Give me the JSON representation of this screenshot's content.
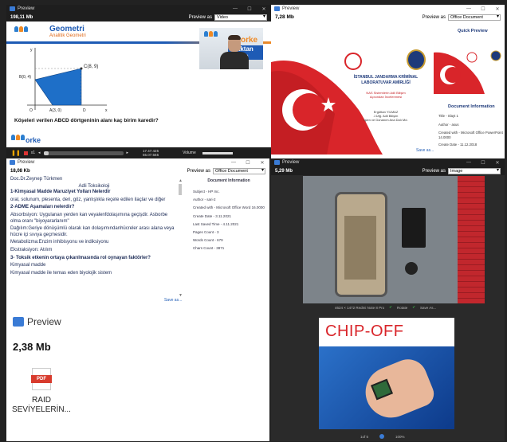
{
  "panels": {
    "video": {
      "title": "Preview",
      "size": "198,11 Mb",
      "preview_as_label": "Preview as",
      "preview_as_value": "Video",
      "slide_title": "Geometri",
      "slide_subtitle": "Analitik Geometri",
      "logo_text": "orke",
      "webcam_brand_line1": "orke",
      "webcam_brand_line2": "uzaktan eğitim",
      "question": "Köşeleri verilen ABCD dörtgeninin alanı kaç birim karedir?",
      "pt_B": "B(0, 4)",
      "pt_C": "C(8, 9)",
      "pt_A": "A(3, 0)",
      "pt_D": "D",
      "axis_x": "x",
      "axis_y": "y",
      "origin": "O",
      "speed": "x1",
      "time_current": "17.47.425",
      "time_total": "55.07.565",
      "volume_label": "Volume"
    },
    "office": {
      "title": "Preview",
      "size": "7,28 Mb",
      "preview_as_label": "Preview as",
      "preview_as_value": "Office Document",
      "quick_preview": "Quick Preview",
      "org_line1": "İSTANBUL JANDARMA KRİMİNAL",
      "org_line2": "LABORATUVAR AMİRLİĞİ",
      "org_sub1": "NAS Sistemlerin Adli Bilişim",
      "org_sub2": "Açısından İncelenmesi",
      "author_name": "Ergüttan YILMAZ",
      "author_role": "J.Ütğ. Adli Bilişim",
      "author_unit": "İşlen ve Donanım Ana Dalı Md.",
      "doc_info_title": "Document Information",
      "info": [
        "Title - Slayt 1",
        "Author - asus",
        "Created with - Microsoft Office PowerPoint 14.0000",
        "Create Date - 11.12.2018"
      ],
      "save_as": "Save as..."
    },
    "word": {
      "title": "Preview",
      "size": "18,08 Kb",
      "preview_as_label": "Preview as",
      "preview_as_value": "Office Document",
      "author": "Doc.Dr.Zeynep Türkmen",
      "heading": "Adli Toksikoloji",
      "lines": [
        {
          "t": "1-Kimyasal Madde Maruziyet Yolları Nelerdir",
          "b": true
        },
        {
          "t": "oral, solunum, plesenta, deri, göz, yanlışlıkla reçete edilen ilaçlar ve diğer",
          "b": false
        },
        {
          "t": "2-ADME Aşamaları nelerdir?",
          "b": true
        },
        {
          "t": "Absorbsiyon: Uygulanan yerden kan veyalenfdolaşımına geçişdir. Asborbe olma oranı \"biyoyararlanım\"",
          "b": false,
          "lead": "Absorbsiyon:"
        },
        {
          "t": "Dağılım:Geriye dönüşümlü olarak kan dolaşımındanhücreler arası alana veya hücre içi sıvıya geçmesidir.",
          "b": false,
          "lead": "Dağılım:"
        },
        {
          "t": "Metabolizma:Enzim inhibisyonu ve indiksiyonu",
          "b": false,
          "lead": "Metabolizma:"
        },
        {
          "t": "Ekstraksiyon: Atılım",
          "b": false,
          "lead": "Ekstraksiyon:"
        },
        {
          "t": "3- Toksik etkenin ortaya çıkarılmasında rol oynayan faktörler?",
          "b": true
        },
        {
          "t": "Kimyasal madde",
          "b": false
        },
        {
          "t": "Kimyasal madde ile temas eden biyolojik sistem",
          "b": false
        }
      ],
      "doc_info_title": "Document Information",
      "info": [
        "Subject - HP Inc.",
        "Author - sari-2",
        "Created with - Microsoft Office Word 16.0000",
        "Create Date - 3.11.2021",
        "Last Saved Time - 4.11.2021",
        "Pages Count - 3",
        "Words Count - 679",
        "Chars Count - 3871"
      ],
      "save_as": "Save as..."
    },
    "image": {
      "title": "Preview",
      "size": "5,29 Mb",
      "preview_as_label": "Preview as",
      "preview_as_value": "Image",
      "footer_info": "4624 × 1472 Redmi Note 8 Pro",
      "rotate": "Rotate",
      "save_as": "Save As..."
    },
    "pdf": {
      "title": "Preview",
      "size": "2,38 Mb",
      "badge": "PDF",
      "filename_line1": "RAID",
      "filename_line2": "SEVİYELERİN..."
    },
    "chip": {
      "heading_part1": "CHIP-",
      "heading_part2": "OFF",
      "page": "1of 5",
      "zoom": "100%"
    }
  },
  "colors": {
    "accent_blue": "#1e5bb5",
    "dark_bg": "#1e1e1e",
    "chip_red": "#d9252a",
    "pdf_red": "#d83b2d"
  }
}
